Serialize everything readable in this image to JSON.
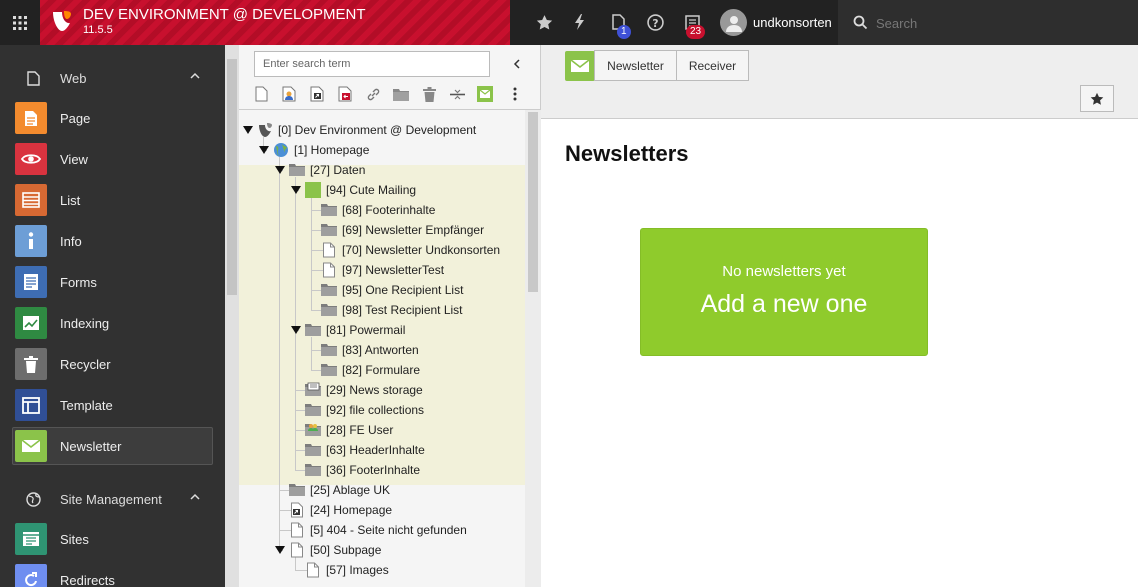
{
  "app": {
    "title": "DEV ENVIRONMENT @ DEVELOPMENT",
    "version": "11.5.5",
    "brand_color": "#c8102e"
  },
  "topbar": {
    "icons": [
      "bookmark-star-icon",
      "flash-icon",
      "document-icon",
      "help-icon",
      "system-info-icon"
    ],
    "document_badge": "1",
    "system_badge": "23",
    "username": "undkonsorten",
    "search_placeholder": "Search"
  },
  "modules": {
    "groups": [
      {
        "label": "Web",
        "items": [
          {
            "label": "Page",
            "color": "#f38b2e",
            "icon": "page-icon"
          },
          {
            "label": "View",
            "color": "#d9333f",
            "icon": "eye-icon"
          },
          {
            "label": "List",
            "color": "#d76933",
            "icon": "list-icon"
          },
          {
            "label": "Info",
            "color": "#6d9ed6",
            "icon": "info-icon"
          },
          {
            "label": "Forms",
            "color": "#3e6db3",
            "icon": "forms-icon"
          },
          {
            "label": "Indexing",
            "color": "#2f8a42",
            "icon": "indexing-icon"
          },
          {
            "label": "Recycler",
            "color": "#6d6d6d",
            "icon": "trash-icon"
          },
          {
            "label": "Template",
            "color": "#304f96",
            "icon": "template-icon"
          },
          {
            "label": "Newsletter",
            "color": "#8bc34a",
            "icon": "envelope-icon",
            "active": true
          }
        ]
      },
      {
        "label": "Site Management",
        "items": [
          {
            "label": "Sites",
            "color": "#2f9473",
            "icon": "sites-icon"
          },
          {
            "label": "Redirects",
            "color": "#6f8ef0",
            "icon": "redirects-icon"
          }
        ]
      }
    ]
  },
  "pagetree": {
    "search_placeholder": "Enter search term",
    "nodes": [
      {
        "label": "[0] Dev Environment @ Development",
        "level": 0,
        "expanded": true,
        "icon": "typo3-root"
      },
      {
        "label": "[1] Homepage",
        "level": 1,
        "expanded": true,
        "icon": "globe"
      },
      {
        "label": "[27] Daten",
        "level": 2,
        "expanded": true,
        "icon": "folder"
      },
      {
        "label": "[94] Cute Mailing",
        "level": 3,
        "expanded": true,
        "icon": "green-square"
      },
      {
        "label": "[68] Footerinhalte",
        "level": 4,
        "icon": "folder"
      },
      {
        "label": "[69] Newsletter Empfänger",
        "level": 4,
        "icon": "folder"
      },
      {
        "label": "[70] Newsletter Undkonsorten",
        "level": 4,
        "icon": "page"
      },
      {
        "label": "[97] NewsletterTest",
        "level": 4,
        "icon": "page"
      },
      {
        "label": "[95] One Recipient List",
        "level": 4,
        "icon": "folder"
      },
      {
        "label": "[98] Test Recipient List",
        "level": 4,
        "icon": "folder"
      },
      {
        "label": "[81] Powermail",
        "level": 3,
        "expanded": true,
        "icon": "folder"
      },
      {
        "label": "[83] Antworten",
        "level": 4,
        "icon": "folder"
      },
      {
        "label": "[82] Formulare",
        "level": 4,
        "icon": "folder"
      },
      {
        "label": "[29] News storage",
        "level": 3,
        "icon": "news-folder"
      },
      {
        "label": "[92] file collections",
        "level": 3,
        "icon": "folder"
      },
      {
        "label": "[28] FE User",
        "level": 3,
        "icon": "users-folder"
      },
      {
        "label": "[63] HeaderInhalte",
        "level": 3,
        "icon": "folder"
      },
      {
        "label": "[36] FooterInhalte",
        "level": 3,
        "icon": "folder"
      },
      {
        "label": "[25] Ablage UK",
        "level": 2,
        "icon": "folder"
      },
      {
        "label": "[24] Homepage",
        "level": 2,
        "icon": "shortcut"
      },
      {
        "label": "[5] 404 - Seite nicht gefunden",
        "level": 2,
        "icon": "page"
      },
      {
        "label": "[50] Subpage",
        "level": 2,
        "expanded": true,
        "icon": "page"
      },
      {
        "label": "[57] Images",
        "level": 3,
        "icon": "page"
      }
    ]
  },
  "docheader": {
    "tabs": [
      "Newsletter",
      "Receiver"
    ]
  },
  "content": {
    "title": "Newsletters",
    "empty_text": "No newsletters yet",
    "add_text": "Add a new one",
    "cta_color": "#8fcb2c"
  }
}
